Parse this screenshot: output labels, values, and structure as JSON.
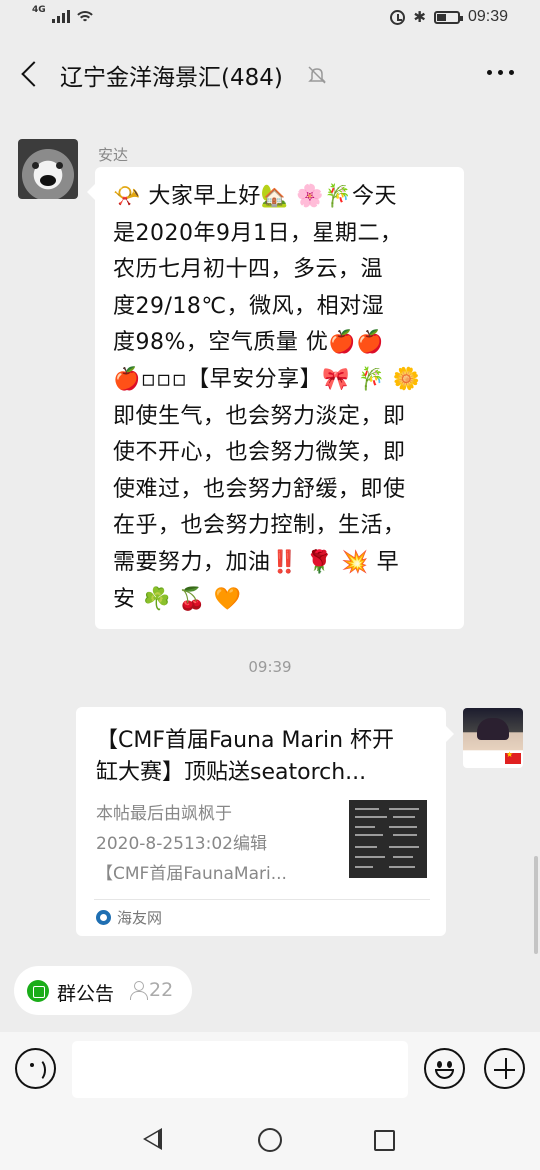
{
  "status_bar": {
    "network": "4G",
    "time": "09:39"
  },
  "header": {
    "title": "辽宁金洋海景汇(484)"
  },
  "messages": [
    {
      "sender": "安达",
      "lines": [
        "📯 大家早上好🏡 🌸🎋今天",
        "是2020年9月1日，星期二，",
        "农历七月初十四，多云，温",
        "度29/18℃，微风，相对湿",
        "度98%，空气质量 优🍎🍎",
        "🍎▫▫▫【早安分享】🎀 🎋 🌼",
        "即使生气，也会努力淡定，即",
        "使不开心，也会努力微笑，即",
        "使难过，也会努力舒缓，即使",
        "在乎，也会努力控制，生活，",
        "需要努力，加油‼️ 🌹 💥 早",
        "安 ☘️ 🍒 🧡"
      ]
    }
  ],
  "timestamp": "09:39",
  "shared_card": {
    "title_line1": "【CMF首届Fauna Marin 杯开",
    "title_line2": "缸大赛】顶贴送seatorch...",
    "desc_line1": "本帖最后由飒枫于",
    "desc_line2": "2020-8-2513:02编辑",
    "desc_line3": "【CMF首届FaunaMari...",
    "source": "海友网"
  },
  "group_notice": {
    "label": "群公告",
    "count": "22"
  },
  "input": {
    "value": ""
  },
  "colors": {
    "background": "#ededed",
    "bubble": "#ffffff",
    "notice_icon": "#1aad19"
  }
}
